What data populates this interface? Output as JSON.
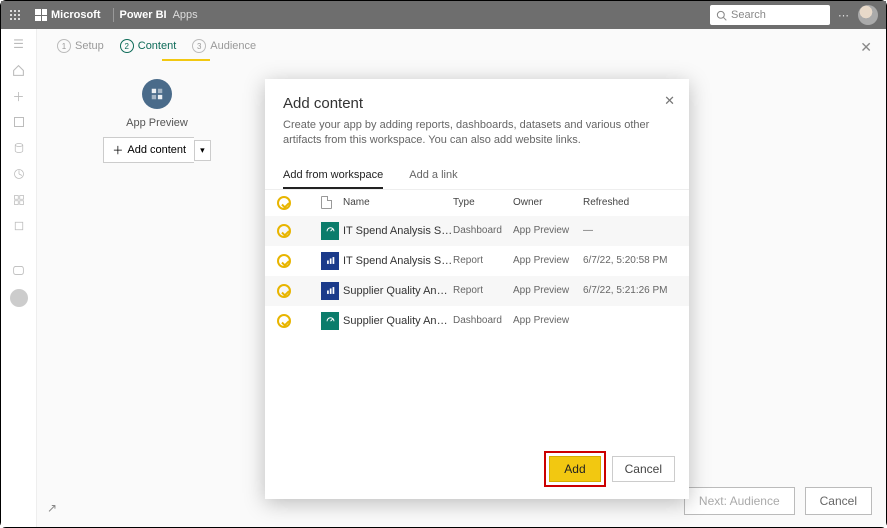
{
  "header": {
    "brand": "Microsoft",
    "product": "Power BI",
    "section": "Apps",
    "search_placeholder": "Search"
  },
  "wizard_steps": {
    "setup": "Setup",
    "content": "Content",
    "audience": "Audience"
  },
  "preview": {
    "title": "App Preview",
    "add_content": "Add content"
  },
  "footer": {
    "next": "Next: Audience",
    "cancel": "Cancel"
  },
  "modal": {
    "title": "Add content",
    "description": "Create your app by adding reports, dashboards, datasets and various other artifacts from this workspace. You can also add website links.",
    "tab_workspace": "Add from workspace",
    "tab_link": "Add a link",
    "columns": {
      "name": "Name",
      "type": "Type",
      "owner": "Owner",
      "refreshed": "Refreshed"
    },
    "rows": [
      {
        "name": "IT Spend Analysis Sample",
        "type": "Dashboard",
        "type_icon": "dash",
        "owner": "App Preview",
        "refreshed": "—"
      },
      {
        "name": "IT Spend Analysis Sample",
        "type": "Report",
        "type_icon": "rep",
        "owner": "App Preview",
        "refreshed": "6/7/22, 5:20:58 PM"
      },
      {
        "name": "Supplier Quality Analysis",
        "type": "Report",
        "type_icon": "rep",
        "owner": "App Preview",
        "refreshed": "6/7/22, 5:21:26 PM"
      },
      {
        "name": "Supplier Quality Analysis S...",
        "type": "Dashboard",
        "type_icon": "dash",
        "owner": "App Preview",
        "refreshed": ""
      }
    ],
    "add": "Add",
    "cancel": "Cancel"
  }
}
